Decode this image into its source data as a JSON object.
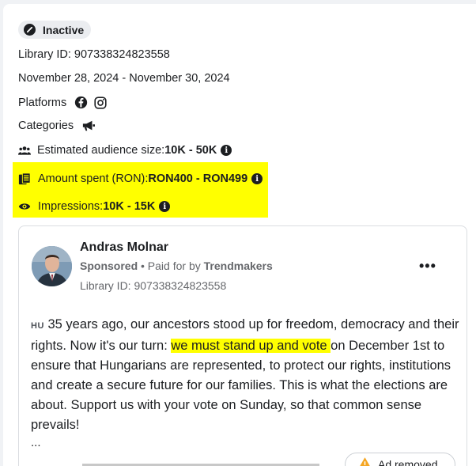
{
  "status": {
    "label": "Inactive",
    "icon": "pencil-off-icon"
  },
  "library_id": "Library ID: 907338324823558",
  "date_range": "November 28, 2024 - November 30, 2024",
  "platforms": {
    "label": "Platforms",
    "icons": [
      "facebook-icon",
      "instagram-icon"
    ]
  },
  "categories": {
    "label": "Categories",
    "icon": "megaphone-icon"
  },
  "audience": {
    "label": "Estimated audience size: ",
    "value": "10K - 50K",
    "icon": "people-icon"
  },
  "amount_spent": {
    "label": "Amount spent (RON): ",
    "value": "RON400 - RON499",
    "icon": "money-icon"
  },
  "impressions": {
    "label": "Impressions: ",
    "value": "10K - 15K",
    "icon": "eye-icon"
  },
  "highlight_color": "#ffff00",
  "ad": {
    "advertiser": "Andras Molnar",
    "sponsored": "Sponsored",
    "paid_for_prefix": " • Paid for by ",
    "payer": "Trendmakers",
    "library_id": "Library ID: 907338324823558",
    "more": "•••",
    "lang": "HU",
    "body_before": " 35 years ago, our ancestors stood up for freedom, democracy and their rights. Now it's our turn: ",
    "body_highlight": "we must stand up and vote ",
    "body_after": "on December 1st to ensure that Hungarians are represented, to protect our rights, institutions and create a secure future for our families. This is what the elections are about. Support us with your vote on Sunday, so that common sense prevails!",
    "ellipsis": "...",
    "removed_label": "Ad removed"
  }
}
